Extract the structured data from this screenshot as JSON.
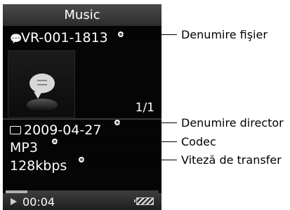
{
  "screen": {
    "title": "Music",
    "file_name": "VR-001-1813",
    "track_counter": "1/1",
    "folder_name": "2009-04-27",
    "codec": "MP3",
    "bitrate": "128kbps",
    "elapsed_time": "00:04",
    "progress_fraction": 0.14,
    "icons": {
      "file": "speech-bubble-icon",
      "folder": "folder-icon",
      "play": "play-icon",
      "battery": "battery-icon",
      "artwork": "voice-memo-artwork"
    }
  },
  "callouts": {
    "file_name": "Denumire fişier",
    "folder_name": "Denumire director",
    "codec": "Codec",
    "bitrate": "Viteză de transfer"
  }
}
